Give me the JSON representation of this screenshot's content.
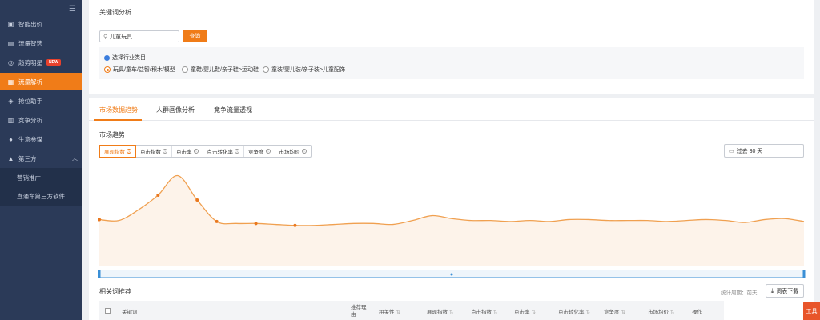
{
  "sidebar": {
    "items": [
      {
        "label": "智能出价",
        "icon": "bid-icon"
      },
      {
        "label": "流量智选",
        "icon": "traffic-icon"
      },
      {
        "label": "趋势明星",
        "icon": "trend-icon",
        "badge": "NEW"
      },
      {
        "label": "流量解析",
        "icon": "analysis-icon",
        "active": true
      },
      {
        "label": "抢位助手",
        "icon": "rank-icon"
      },
      {
        "label": "竞争分析",
        "icon": "compete-icon"
      },
      {
        "label": "生意参谋",
        "icon": "business-icon"
      },
      {
        "label": "第三方",
        "icon": "third-party-icon"
      }
    ],
    "sub_items": [
      {
        "label": "营销推广"
      },
      {
        "label": "直通车第三方软件"
      }
    ]
  },
  "keyword_section": {
    "title": "关键词分析",
    "search_value": "儿童玩具",
    "query_button": "查询",
    "industry_label": "选择行业类目",
    "options": [
      {
        "label": "玩具/童车/益智/积木/模型",
        "selected": true
      },
      {
        "label": "童鞋/婴儿鞋/亲子鞋>运动鞋",
        "selected": false
      },
      {
        "label": "童装/婴儿装/亲子装>儿童配饰",
        "selected": false
      }
    ]
  },
  "tabs": [
    {
      "label": "市场数据趋势",
      "active": true
    },
    {
      "label": "人群画像分析",
      "active": false
    },
    {
      "label": "竞争流量透视",
      "active": false
    }
  ],
  "market": {
    "title": "市场趋势",
    "metrics": [
      {
        "label": "展现指数",
        "active": true
      },
      {
        "label": "点击指数",
        "active": false
      },
      {
        "label": "点击率",
        "active": false
      },
      {
        "label": "点击转化率",
        "active": false
      },
      {
        "label": "竞争度",
        "active": false
      },
      {
        "label": "市场均价",
        "active": false
      }
    ],
    "date_range": "过去 30 天"
  },
  "chart_data": {
    "type": "area",
    "series": [
      {
        "color": "#f0a050",
        "values": [
          48,
          47,
          58,
          73,
          93,
          68,
          46,
          44,
          44,
          43,
          42,
          42,
          43,
          44,
          44,
          43,
          47,
          52,
          49,
          47,
          47,
          46,
          47,
          46,
          48,
          48,
          47,
          47,
          47,
          46,
          47,
          48,
          47,
          45,
          48,
          49,
          46
        ]
      }
    ],
    "markers": [
      0,
      3,
      5,
      6,
      8,
      10
    ],
    "grid": false,
    "legend": "none"
  },
  "recommend": {
    "title": "相关词推荐",
    "stat_period": "统计周期：前天",
    "download": "词表下载",
    "columns": [
      {
        "label": "关键词",
        "sortable": false
      },
      {
        "label": "推荐理由",
        "sortable": false
      },
      {
        "label": "相关性",
        "sortable": true
      },
      {
        "label": "展现指数",
        "sortable": true
      },
      {
        "label": "点击指数",
        "sortable": true
      },
      {
        "label": "点击率",
        "sortable": true
      },
      {
        "label": "点击转化率",
        "sortable": true
      },
      {
        "label": "竞争度",
        "sortable": true
      },
      {
        "label": "市场均价",
        "sortable": true
      },
      {
        "label": "操作",
        "sortable": false
      }
    ]
  },
  "float_button": "工具"
}
